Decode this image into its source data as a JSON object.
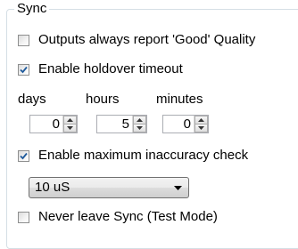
{
  "group": {
    "title": "Sync"
  },
  "checkboxes": {
    "outputs_good": {
      "label": "Outputs always report 'Good' Quality",
      "checked": false
    },
    "holdover": {
      "label": "Enable holdover timeout",
      "checked": true
    },
    "max_inaccuracy": {
      "label": "Enable maximum inaccuracy check",
      "checked": true
    },
    "never_leave": {
      "label": "Never leave Sync (Test Mode)",
      "checked": false
    }
  },
  "timeout": {
    "days_label": "days",
    "hours_label": "hours",
    "minutes_label": "minutes",
    "days_value": "0",
    "hours_value": "5",
    "minutes_value": "0"
  },
  "inaccuracy": {
    "selected": "10 uS"
  },
  "colors": {
    "check_mark": "#1e5a9c",
    "border": "#abadb3",
    "group_border": "#d5dfe5"
  },
  "icons": {
    "spin_up": "up-arrow-icon",
    "spin_down": "down-arrow-icon",
    "dropdown": "chevron-down-icon",
    "check": "checkmark-icon"
  }
}
